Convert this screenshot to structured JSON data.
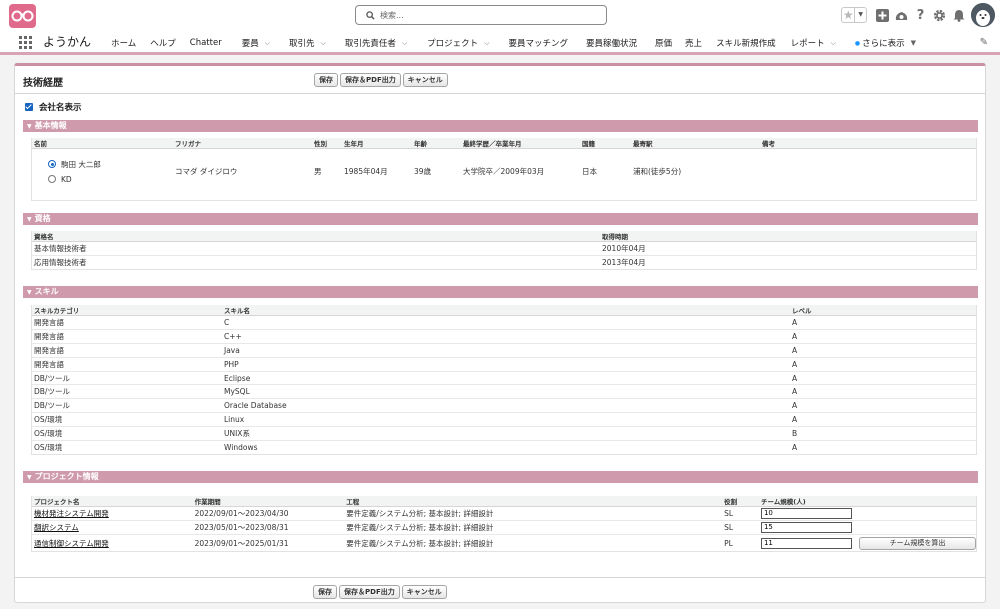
{
  "header": {
    "search_placeholder": "検索...",
    "icons": [
      "star-icon",
      "chevron-down-icon",
      "plus-icon",
      "trailhead-icon",
      "help-icon",
      "gear-icon",
      "bell-icon",
      "avatar"
    ]
  },
  "nav": {
    "app_name": "ようかん",
    "items": [
      {
        "label": "ホーム",
        "chevron": false
      },
      {
        "label": "ヘルプ",
        "chevron": false
      },
      {
        "label": "Chatter",
        "chevron": false
      },
      {
        "label": "要員",
        "chevron": true
      },
      {
        "label": "取引先",
        "chevron": true
      },
      {
        "label": "取引先責任者",
        "chevron": true
      },
      {
        "label": "プロジェクト",
        "chevron": true
      },
      {
        "label": "要員マッチング",
        "chevron": false
      },
      {
        "label": "要員稼働状況",
        "chevron": false
      },
      {
        "label": "原価",
        "chevron": false
      },
      {
        "label": "売上",
        "chevron": false
      },
      {
        "label": "スキル新規作成",
        "chevron": false
      },
      {
        "label": "レポート",
        "chevron": true
      },
      {
        "label": "さらに表示",
        "chevron": true
      }
    ]
  },
  "page": {
    "title": "技術経歴",
    "buttons": {
      "save": "保存",
      "save_pdf": "保存＆PDF出力",
      "cancel": "キャンセル"
    },
    "company_display_label": "会社名表示",
    "company_display_checked": true
  },
  "basic": {
    "section_title": "基本情報",
    "headers": {
      "name": "名前",
      "kana": "フリガナ",
      "gender": "性別",
      "birth": "生年月",
      "age": "年齢",
      "education": "最終学歴／卒業年月",
      "nationality": "国籍",
      "station": "最寄駅",
      "notes": "備考"
    },
    "name_options": [
      {
        "label": "駒田 大二郎",
        "selected": true
      },
      {
        "label": "KD",
        "selected": false
      }
    ],
    "kana": "コマダ ダイジロウ",
    "gender": "男",
    "birth": "1985年04月",
    "age": "39歳",
    "education": "大学院卒／2009年03月",
    "nationality": "日本",
    "station": "浦和(徒歩5分)",
    "notes": ""
  },
  "qualifications": {
    "section_title": "資格",
    "headers": {
      "name": "資格名",
      "date": "取得時期"
    },
    "rows": [
      {
        "name": "基本情報技術者",
        "date": "2010年04月"
      },
      {
        "name": "応用情報技術者",
        "date": "2013年04月"
      }
    ]
  },
  "skills": {
    "section_title": "スキル",
    "headers": {
      "category": "スキルカテゴリ",
      "name": "スキル名",
      "level": "レベル"
    },
    "rows": [
      {
        "category": "開発言語",
        "name": "C",
        "level": "A"
      },
      {
        "category": "開発言語",
        "name": "C++",
        "level": "A"
      },
      {
        "category": "開発言語",
        "name": "Java",
        "level": "A"
      },
      {
        "category": "開発言語",
        "name": "PHP",
        "level": "A"
      },
      {
        "category": "DB/ツール",
        "name": "Eclipse",
        "level": "A"
      },
      {
        "category": "DB/ツール",
        "name": "MySQL",
        "level": "A"
      },
      {
        "category": "DB/ツール",
        "name": "Oracle Database",
        "level": "A"
      },
      {
        "category": "OS/環境",
        "name": "Linux",
        "level": "A"
      },
      {
        "category": "OS/環境",
        "name": "UNIX系",
        "level": "B"
      },
      {
        "category": "OS/環境",
        "name": "Windows",
        "level": "A"
      }
    ]
  },
  "projects": {
    "section_title": "プロジェクト情報",
    "headers": {
      "name": "プロジェクト名",
      "period": "作業期間",
      "process": "工程",
      "role": "役割",
      "team": "チーム規模(人)"
    },
    "rows": [
      {
        "name": "機材発注システム開発",
        "period": "2022/09/01～2023/04/30",
        "process": "要件定義/システム分析; 基本設計; 詳細設計",
        "role": "SL",
        "team": "10"
      },
      {
        "name": "翻訳システム",
        "period": "2023/05/01～2023/08/31",
        "process": "要件定義/システム分析; 基本設計; 詳細設計",
        "role": "SL",
        "team": "15"
      },
      {
        "name": "通信制御システム開発",
        "period": "2023/09/01～2025/01/31",
        "process": "要件定義/システム分析; 基本設計; 詳細設計",
        "role": "PL",
        "team": "11"
      }
    ],
    "calc_button": "チーム規模を算出"
  }
}
